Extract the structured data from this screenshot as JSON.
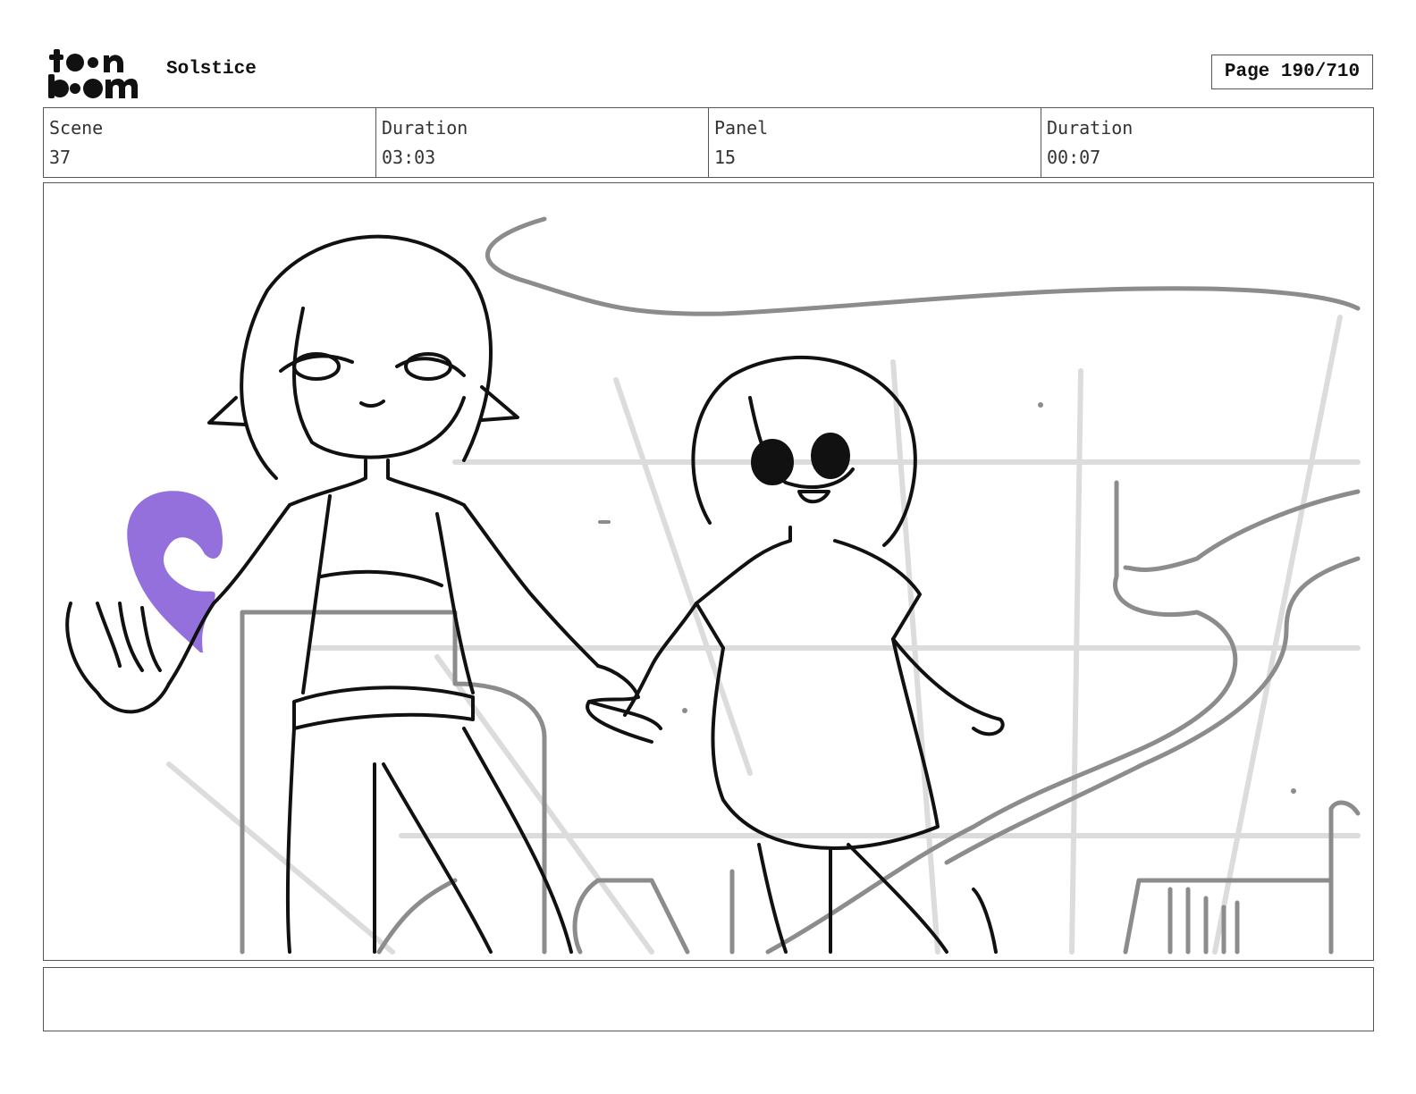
{
  "header": {
    "logo_text": "toon boom",
    "project_title": "Solstice",
    "page_label": "Page 190/710"
  },
  "info": [
    {
      "label": "Scene",
      "value": "37"
    },
    {
      "label": "Duration",
      "value": "03:03"
    },
    {
      "label": "Panel",
      "value": "15"
    },
    {
      "label": "Duration",
      "value": "00:07"
    }
  ],
  "panel": {
    "description": "",
    "accent_color": "#9370db",
    "line_color": "#111111",
    "background_sketch_color": "#8c8c8c"
  },
  "caption": {
    "text": ""
  }
}
